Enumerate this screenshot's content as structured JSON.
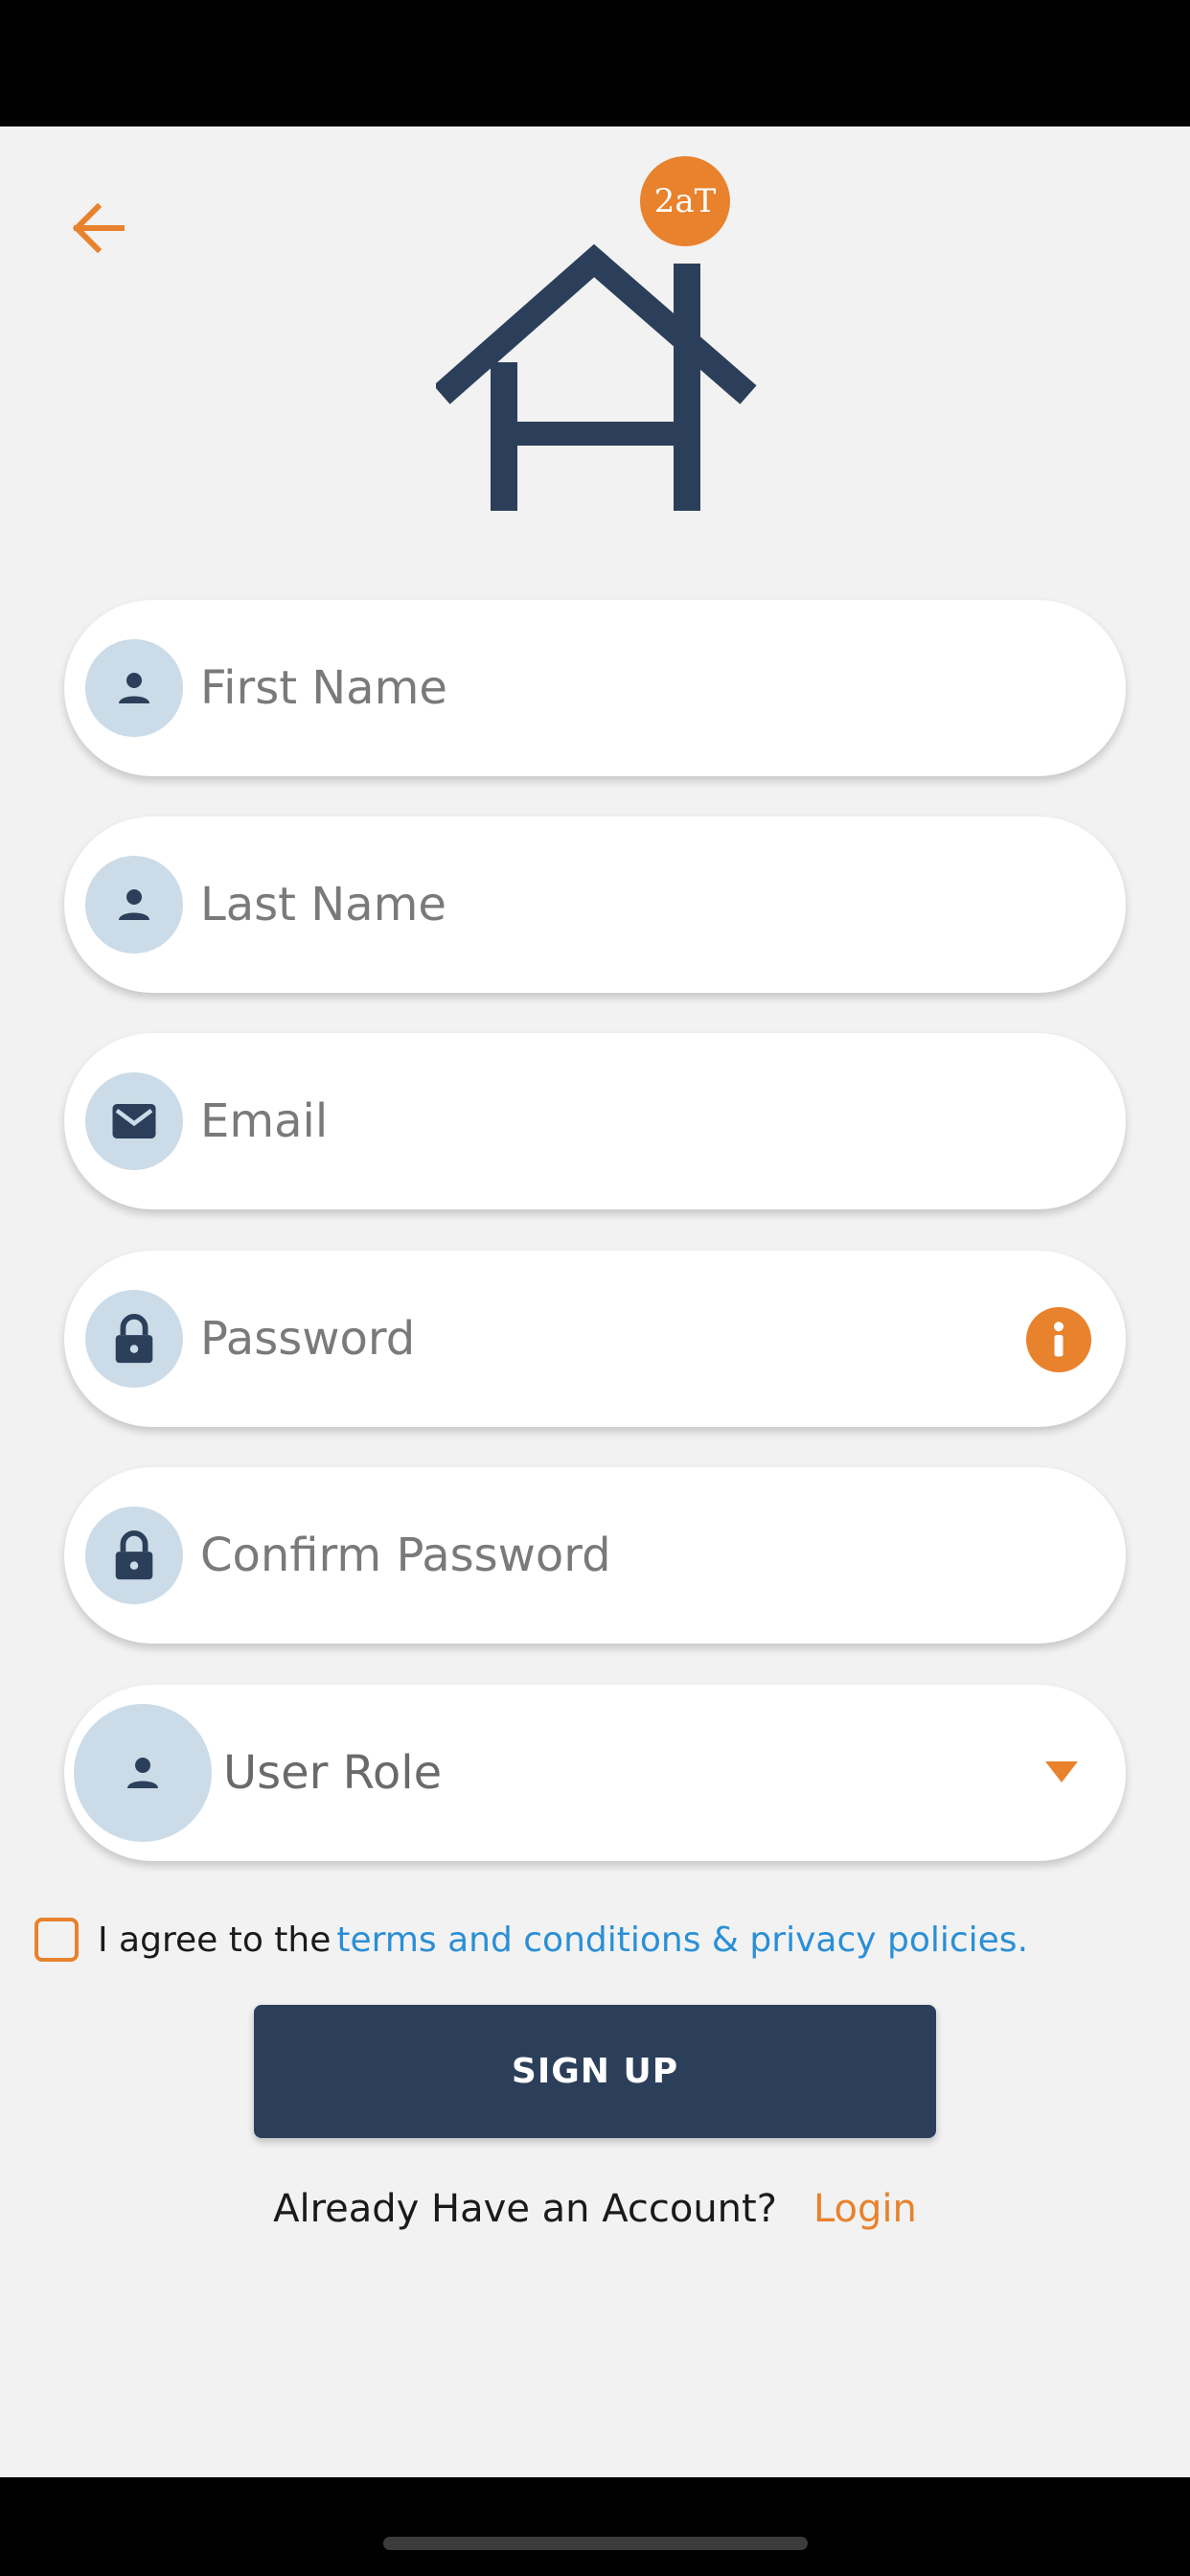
{
  "colors": {
    "accent": "#e8822d",
    "navy": "#2c3f5a",
    "icon_circle": "#cbdce8",
    "link": "#2a8fd6",
    "background": "#f2f2f2"
  },
  "logo": {
    "badge_text": "2aT"
  },
  "form": {
    "first_name": {
      "placeholder": "First Name",
      "icon": "person-icon"
    },
    "last_name": {
      "placeholder": "Last Name",
      "icon": "person-icon"
    },
    "email": {
      "placeholder": "Email",
      "icon": "mail-icon"
    },
    "password": {
      "placeholder": "Password",
      "icon": "lock-icon",
      "trailing_icon": "info-icon"
    },
    "confirm_password": {
      "placeholder": "Confirm Password",
      "icon": "lock-icon"
    },
    "user_role": {
      "label": "User Role",
      "icon": "person-icon",
      "trailing_icon": "caret-down-icon"
    }
  },
  "terms": {
    "checked": false,
    "text": "I agree to the",
    "link_text": "terms and conditions & privacy policies."
  },
  "signup_button": {
    "label": "SIGN UP"
  },
  "login": {
    "prompt": "Already Have an Account?",
    "link": "Login"
  }
}
